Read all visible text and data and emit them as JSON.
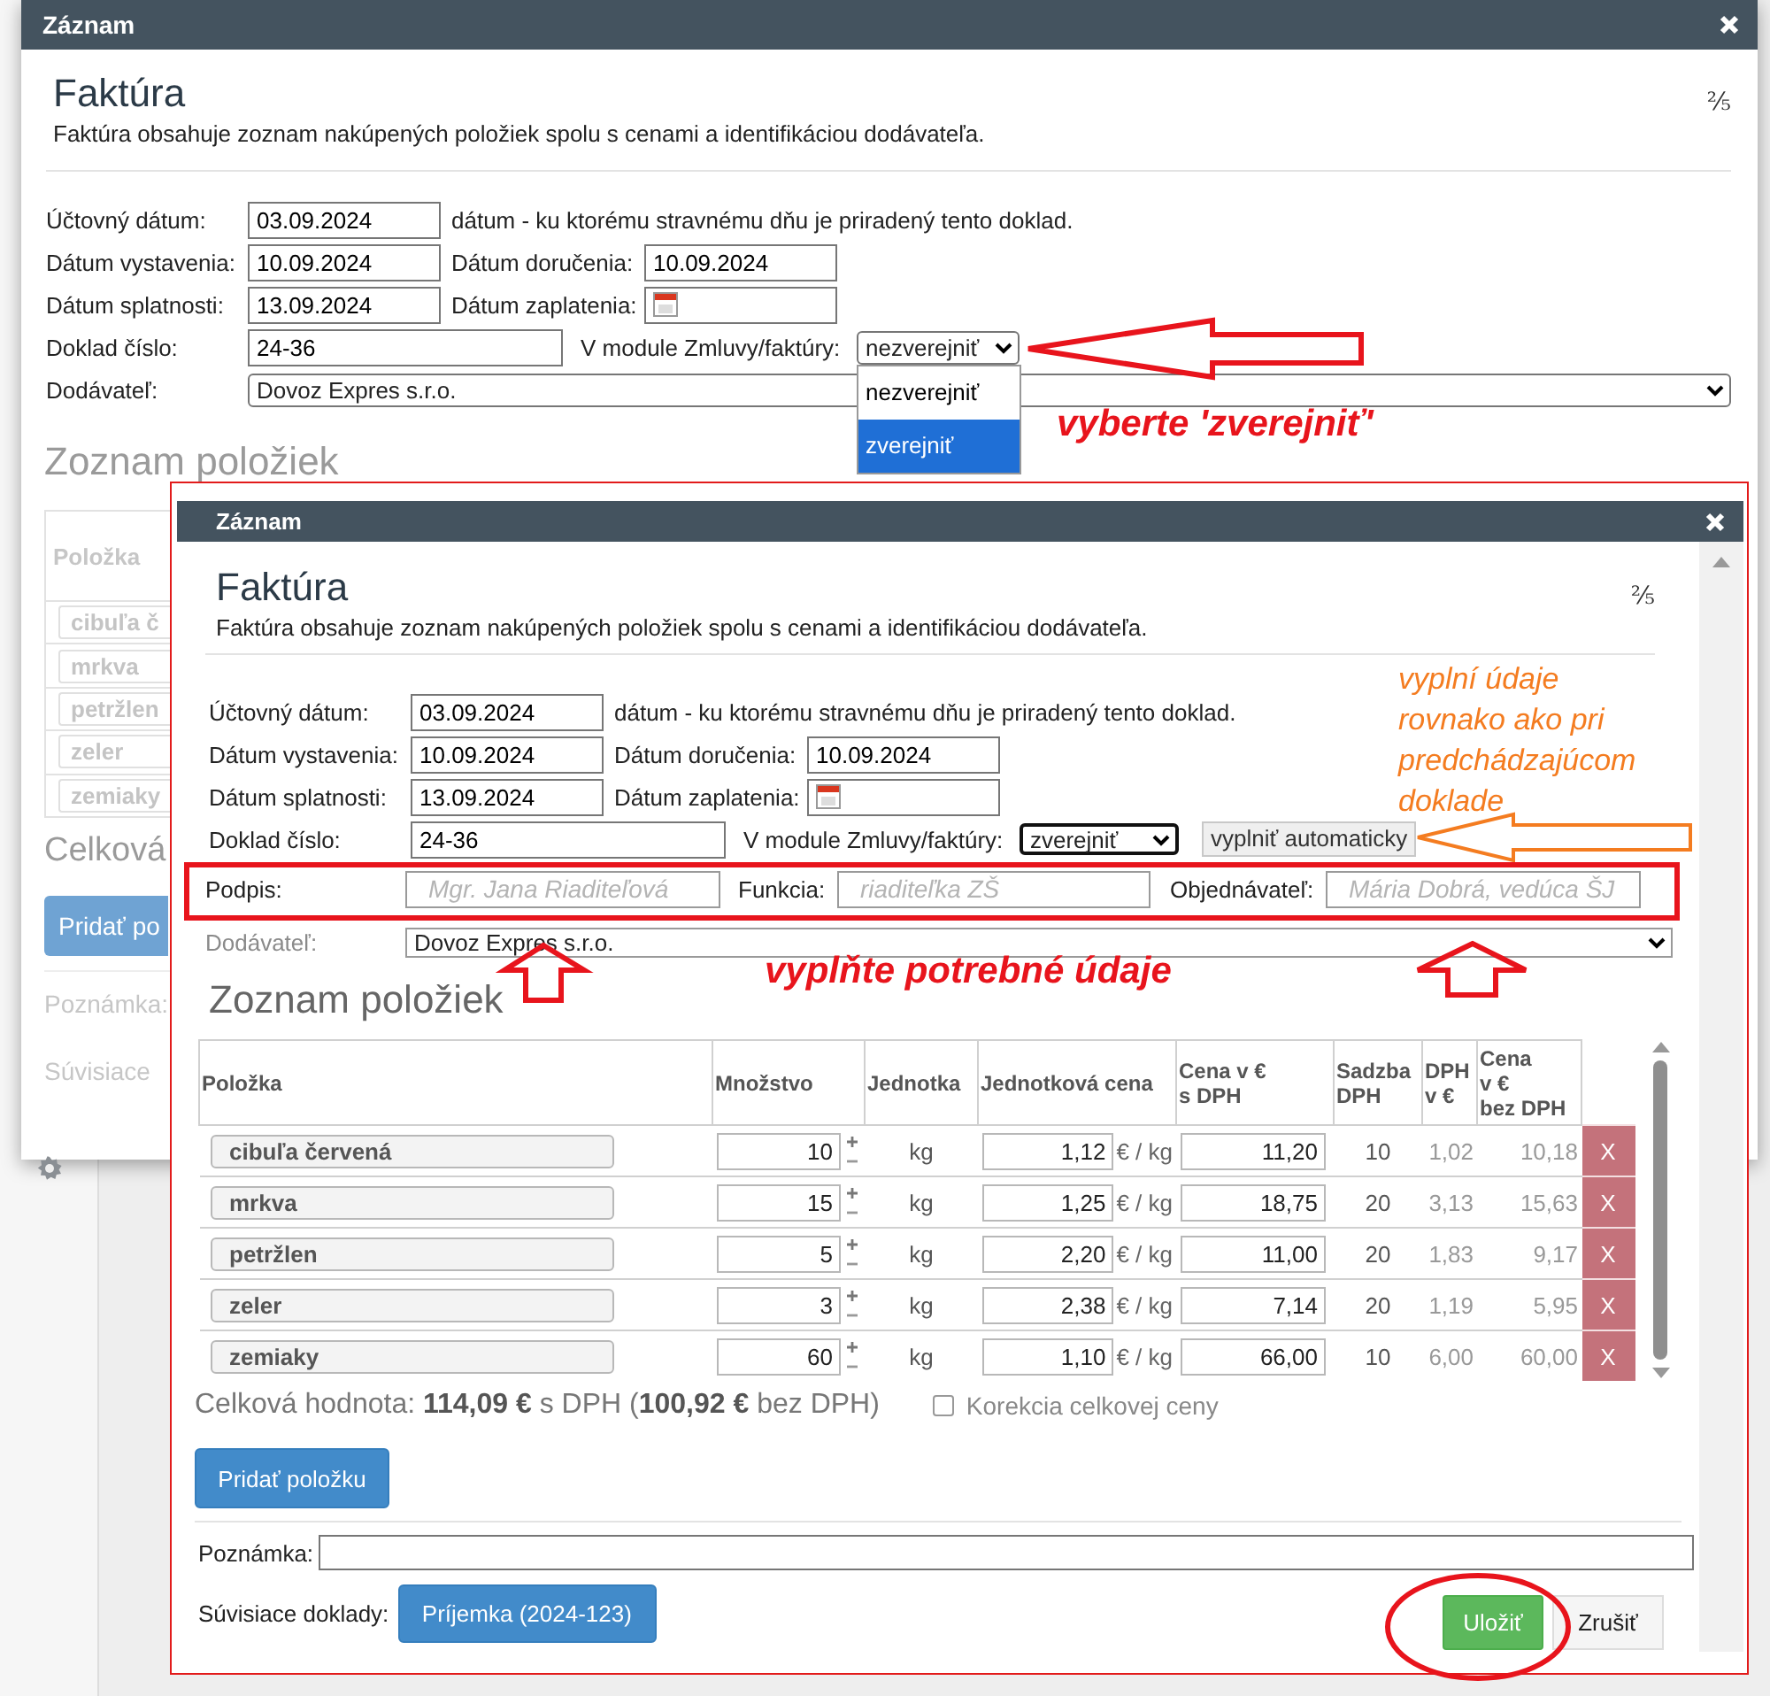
{
  "back_dialog": {
    "title": "Záznam",
    "heading": "Faktúra",
    "page_indicator": "⅖",
    "description": "Faktúra obsahuje zoznam nakúpených položiek spolu s cenami a identifikáciou dodávateľa.",
    "accounting_date": {
      "label": "Účtovný dátum:",
      "value": "03.09.2024",
      "note": "dátum - ku ktorému stravnému dňu je priradený tento doklad."
    },
    "issue_date": {
      "label": "Dátum vystavenia:",
      "value": "10.09.2024"
    },
    "delivery_date": {
      "label": "Dátum doručenia:",
      "value": "10.09.2024"
    },
    "due_date": {
      "label": "Dátum splatnosti:",
      "value": "13.09.2024"
    },
    "payment_date": {
      "label": "Dátum zaplatenia:"
    },
    "document_number": {
      "label": "Doklad číslo:",
      "value": "24-36"
    },
    "contracts_module": {
      "label": "V module Zmluvy/faktúry:",
      "value": "nezverejniť",
      "options": [
        {
          "label": "nezverejniť",
          "highlighted": false
        },
        {
          "label": "zverejniť",
          "highlighted": true
        }
      ]
    },
    "supplier": {
      "label": "Dodávateľ:",
      "value": "Dovoz Expres s.r.o."
    },
    "items_heading": "Zoznam položiek",
    "items_column": "Položka",
    "items": [
      "cibuľa č",
      "mrkva",
      "petržlen",
      "zeler",
      "zemiaky"
    ],
    "total_label": "Celková",
    "add_button": "Pridať po",
    "note_label": "Poznámka:",
    "related_label": "Súvisiace"
  },
  "front_dialog": {
    "title": "Záznam",
    "heading": "Faktúra",
    "page_indicator": "⅖",
    "description": "Faktúra obsahuje zoznam nakúpených položiek spolu s cenami a identifikáciou dodávateľa.",
    "accounting_date": {
      "label": "Účtovný dátum:",
      "value": "03.09.2024",
      "note": "dátum - ku ktorému stravnému dňu je priradený tento doklad."
    },
    "issue_date": {
      "label": "Dátum vystavenia:",
      "value": "10.09.2024"
    },
    "delivery_date": {
      "label": "Dátum doručenia:",
      "value": "10.09.2024"
    },
    "due_date": {
      "label": "Dátum splatnosti:",
      "value": "13.09.2024"
    },
    "payment_date": {
      "label": "Dátum zaplatenia:"
    },
    "document_number": {
      "label": "Doklad číslo:",
      "value": "24-36"
    },
    "contracts_module": {
      "label": "V module Zmluvy/faktúry:",
      "value": "zverejniť"
    },
    "autofill_button": "vyplniť automaticky",
    "signature": {
      "label": "Podpis:",
      "placeholder": "Mgr. Jana Riaditeľová"
    },
    "function": {
      "label": "Funkcia:",
      "placeholder": "riaditeľka ZŠ"
    },
    "orderer": {
      "label": "Objednávateľ:",
      "placeholder": "Mária Dobrá, vedúca ŠJ"
    },
    "supplier": {
      "label": "Dodávateľ:",
      "value": "Dovoz Expres s.r.o."
    },
    "items_heading": "Zoznam položiek",
    "table": {
      "columns": [
        "Položka",
        "Množstvo",
        "Jednotka",
        "Jednotková cena",
        "Cena v €\ns DPH",
        "Sadzba\nDPH",
        "DPH\nv €",
        "Cena\nv €\nbez DPH"
      ],
      "rows": [
        {
          "item": "cibuľa červená",
          "quantity": "10",
          "unit": "kg",
          "unit_price": "1,12",
          "price_unit": "€ / kg",
          "price_with_vat": "11,20",
          "vat_rate": "10",
          "vat": "1,02",
          "price_without_vat": "10,18",
          "delete": "X"
        },
        {
          "item": "mrkva",
          "quantity": "15",
          "unit": "kg",
          "unit_price": "1,25",
          "price_unit": "€ / kg",
          "price_with_vat": "18,75",
          "vat_rate": "20",
          "vat": "3,13",
          "price_without_vat": "15,63",
          "delete": "X"
        },
        {
          "item": "petržlen",
          "quantity": "5",
          "unit": "kg",
          "unit_price": "2,20",
          "price_unit": "€ / kg",
          "price_with_vat": "11,00",
          "vat_rate": "20",
          "vat": "1,83",
          "price_without_vat": "9,17",
          "delete": "X"
        },
        {
          "item": "zeler",
          "quantity": "3",
          "unit": "kg",
          "unit_price": "2,38",
          "price_unit": "€ / kg",
          "price_with_vat": "7,14",
          "vat_rate": "20",
          "vat": "1,19",
          "price_without_vat": "5,95",
          "delete": "X"
        },
        {
          "item": "zemiaky",
          "quantity": "60",
          "unit": "kg",
          "unit_price": "1,10",
          "price_unit": "€ / kg",
          "price_with_vat": "66,00",
          "vat_rate": "10",
          "vat": "6,00",
          "price_without_vat": "60,00",
          "delete": "X"
        }
      ]
    },
    "total": "Celková hodnota: **114,09 €** s DPH (**100,92 €** bez DPH)",
    "price_correction": {
      "label": "Korekcia celkovej ceny",
      "checked": false
    },
    "add_button": "Pridať položku",
    "note": {
      "label": "Poznámka:"
    },
    "related": {
      "label": "Súvisiace doklady:",
      "button": "Príjemka (2024-123)"
    },
    "save_button": "Uložiť",
    "cancel_button": "Zrušiť"
  },
  "annotations": {
    "select_hint": "vyberte 'zverejniť'",
    "autofill_hint": "vyplní údaje rovnako ako pri predchádzajúcom doklade",
    "fill_hint": "vyplňte potrebné údaje"
  }
}
